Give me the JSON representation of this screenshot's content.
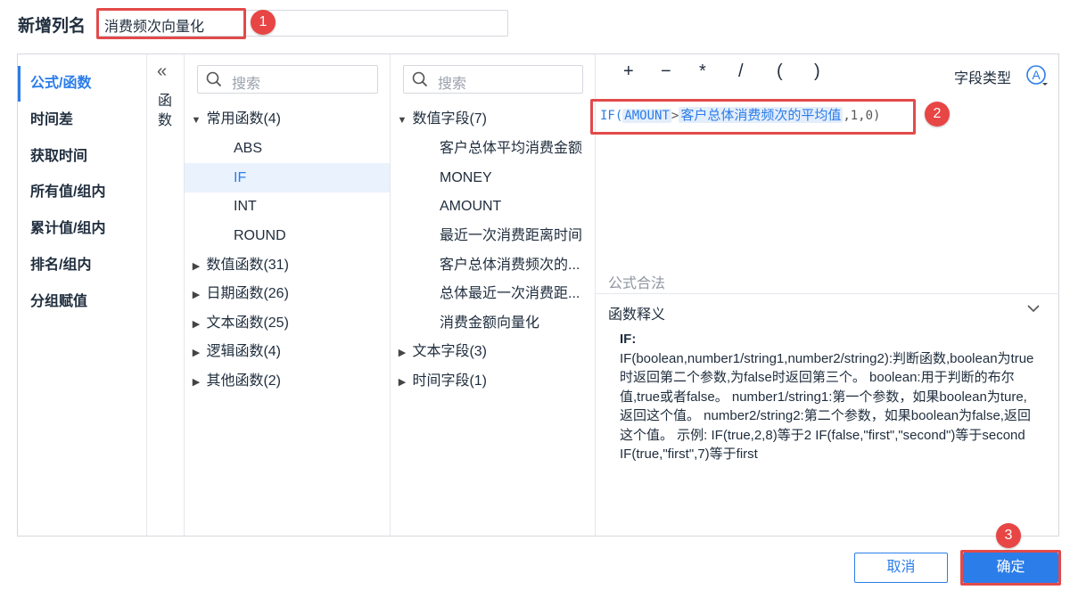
{
  "header": {
    "title": "新增列名",
    "column_name_value": "消费频次向量化"
  },
  "callouts": [
    "1",
    "2",
    "3"
  ],
  "categories": [
    {
      "label": "公式/函数",
      "active": true
    },
    {
      "label": "时间差"
    },
    {
      "label": "获取时间"
    },
    {
      "label": "所有值/组内"
    },
    {
      "label": "累计值/组内"
    },
    {
      "label": "排名/组内"
    },
    {
      "label": "分组赋值"
    }
  ],
  "collapse": {
    "icon": "double-chevron-left-icon",
    "vertical_label": "函数"
  },
  "function_panel": {
    "search_placeholder": "搜索",
    "groups": [
      {
        "label": "常用函数(4)",
        "expanded": true,
        "children": [
          "ABS",
          "IF",
          "INT",
          "ROUND"
        ],
        "selected": "IF"
      },
      {
        "label": "数值函数(31)"
      },
      {
        "label": "日期函数(26)"
      },
      {
        "label": "文本函数(25)"
      },
      {
        "label": "逻辑函数(4)"
      },
      {
        "label": "其他函数(2)"
      }
    ]
  },
  "field_panel": {
    "search_placeholder": "搜索",
    "groups": [
      {
        "label": "数值字段(7)",
        "expanded": true,
        "children": [
          "客户总体平均消费金额",
          "MONEY",
          "AMOUNT",
          "最近一次消费距离时间",
          "客户总体消费频次的...",
          "总体最近一次消费距...",
          "消费金额向量化"
        ]
      },
      {
        "label": "文本字段(3)"
      },
      {
        "label": "时间字段(1)"
      }
    ]
  },
  "editor": {
    "operators": [
      "+",
      "−",
      "*",
      "/",
      "(",
      ")"
    ],
    "field_type_label": "字段类型",
    "field_type_icon": "letter-a-circle-icon",
    "formula": {
      "fn": "IF(",
      "token1": "AMOUNT",
      "op": ">",
      "token2": "客户总体消费频次的平均值",
      "tail": ",1,0)"
    },
    "validity": "公式合法",
    "explain_title": "函数释义",
    "explain_name": "IF:",
    "explain_text": "IF(boolean,number1/string1,number2/string2):判断函数,boolean为true时返回第二个参数,为false时返回第三个。 boolean:用于判断的布尔值,true或者false。 number1/string1:第一个参数，如果boolean为ture,返回这个值。 number2/string2:第二个参数，如果boolean为false,返回这个值。 示例: IF(true,2,8)等于2 IF(false,\"first\",\"second\")等于second IF(true,\"first\",7)等于first"
  },
  "footer": {
    "cancel_label": "取消",
    "ok_label": "确定"
  },
  "colors": {
    "accent": "#2b7de9",
    "callout": "#e84545",
    "selected_bg": "#eaf2fd"
  }
}
